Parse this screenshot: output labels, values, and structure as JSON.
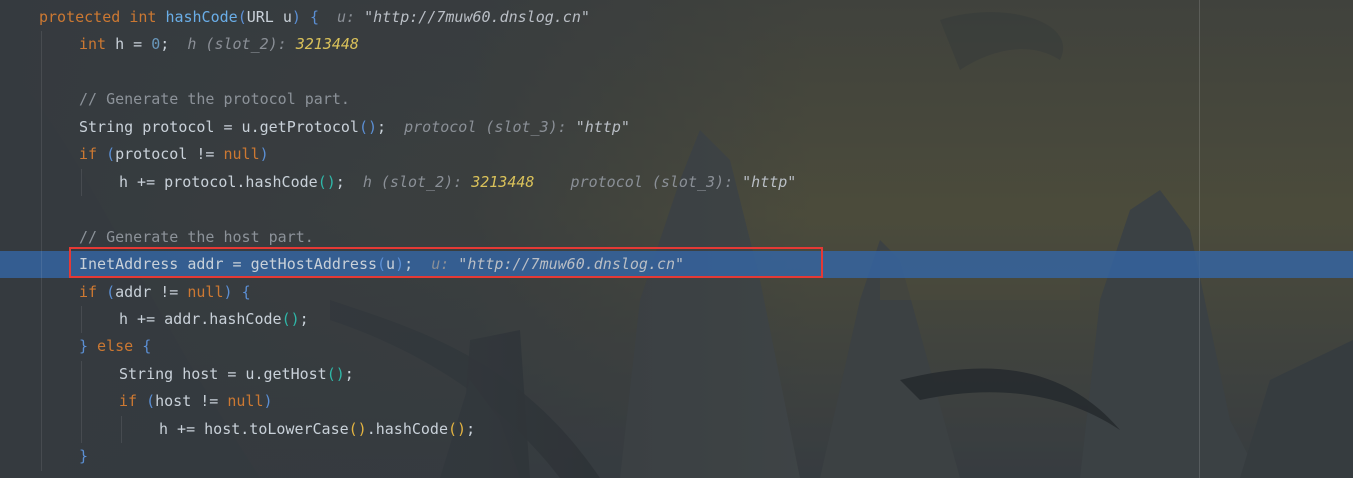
{
  "editor": {
    "language": "java",
    "highlighted_line": "InetAddress addr = getHostAddress(u);",
    "lines": [
      {
        "indent": 0,
        "tokens": [
          [
            "kw",
            "protected "
          ],
          [
            "kw",
            "int "
          ],
          [
            "fn",
            "hashCode"
          ],
          [
            "pb",
            "("
          ],
          [
            "id",
            "URL u"
          ],
          [
            "pb",
            ")"
          ],
          [
            "id",
            " "
          ],
          [
            "pb",
            "{"
          ]
        ],
        "hint": [
          [
            "hint",
            "u: "
          ],
          [
            "hintval",
            "\"http://7muw60.dnslog.cn\""
          ]
        ]
      },
      {
        "indent": 1,
        "tokens": [
          [
            "kw",
            "int "
          ],
          [
            "id",
            "h = "
          ],
          [
            "num",
            "0"
          ],
          [
            "id",
            ";"
          ]
        ],
        "hint": [
          [
            "hint",
            "h (slot_2): "
          ],
          [
            "hintnum",
            "3213448"
          ]
        ]
      },
      {
        "indent": 1,
        "tokens": [],
        "hint": []
      },
      {
        "indent": 1,
        "tokens": [
          [
            "cmt",
            "// Generate the protocol part."
          ]
        ],
        "hint": []
      },
      {
        "indent": 1,
        "tokens": [
          [
            "id",
            "String protocol = u.getProtocol"
          ],
          [
            "pb",
            "()"
          ],
          [
            "id",
            ";"
          ]
        ],
        "hint": [
          [
            "hint",
            "protocol (slot_3): "
          ],
          [
            "hintval",
            "\"http\""
          ]
        ]
      },
      {
        "indent": 1,
        "tokens": [
          [
            "kw",
            "if "
          ],
          [
            "pb",
            "("
          ],
          [
            "id",
            "protocol != "
          ],
          [
            "kw",
            "null"
          ],
          [
            "pb",
            ")"
          ]
        ],
        "hint": []
      },
      {
        "indent": 2,
        "tokens": [
          [
            "id",
            "h += protocol.hashCode"
          ],
          [
            "pg",
            "()"
          ],
          [
            "id",
            ";"
          ]
        ],
        "hint": [
          [
            "hint",
            "h (slot_2): "
          ],
          [
            "hintnum",
            "3213448"
          ],
          [
            "hint",
            "    protocol (slot_3): "
          ],
          [
            "hintval",
            "\"http\""
          ]
        ]
      },
      {
        "indent": 1,
        "tokens": [],
        "hint": []
      },
      {
        "indent": 1,
        "tokens": [
          [
            "cmt",
            "// Generate the host part."
          ]
        ],
        "hint": []
      },
      {
        "indent": 1,
        "tokens": [
          [
            "id",
            "InetAddress addr = getHostAddress"
          ],
          [
            "pb",
            "("
          ],
          [
            "id",
            "u"
          ],
          [
            "pb",
            ")"
          ],
          [
            "id",
            ";"
          ]
        ],
        "hint": [
          [
            "hint",
            "u: "
          ],
          [
            "hintval",
            "\"http://7muw60.dnslog.cn\""
          ]
        ],
        "current": true
      },
      {
        "indent": 1,
        "tokens": [
          [
            "kw",
            "if "
          ],
          [
            "pb",
            "("
          ],
          [
            "id",
            "addr != "
          ],
          [
            "kw",
            "null"
          ],
          [
            "pb",
            ")"
          ],
          [
            "id",
            " "
          ],
          [
            "pb",
            "{"
          ]
        ],
        "hint": []
      },
      {
        "indent": 2,
        "tokens": [
          [
            "id",
            "h += addr.hashCode"
          ],
          [
            "pg",
            "()"
          ],
          [
            "id",
            ";"
          ]
        ],
        "hint": []
      },
      {
        "indent": 1,
        "tokens": [
          [
            "pb",
            "}"
          ],
          [
            "kw",
            " else "
          ],
          [
            "pb",
            "{"
          ]
        ],
        "hint": []
      },
      {
        "indent": 2,
        "tokens": [
          [
            "id",
            "String host = u.getHost"
          ],
          [
            "pg",
            "()"
          ],
          [
            "id",
            ";"
          ]
        ],
        "hint": []
      },
      {
        "indent": 2,
        "tokens": [
          [
            "kw",
            "if "
          ],
          [
            "pb",
            "("
          ],
          [
            "id",
            "host != "
          ],
          [
            "kw",
            "null"
          ],
          [
            "pb",
            ")"
          ]
        ],
        "hint": []
      },
      {
        "indent": 3,
        "tokens": [
          [
            "id",
            "h += host.toLowerCase"
          ],
          [
            "py",
            "()"
          ],
          [
            "id",
            ".hashCode"
          ],
          [
            "py",
            "()"
          ],
          [
            "id",
            ";"
          ]
        ],
        "hint": []
      },
      {
        "indent": 1,
        "tokens": [
          [
            "pb",
            "}"
          ]
        ],
        "hint": []
      }
    ]
  }
}
